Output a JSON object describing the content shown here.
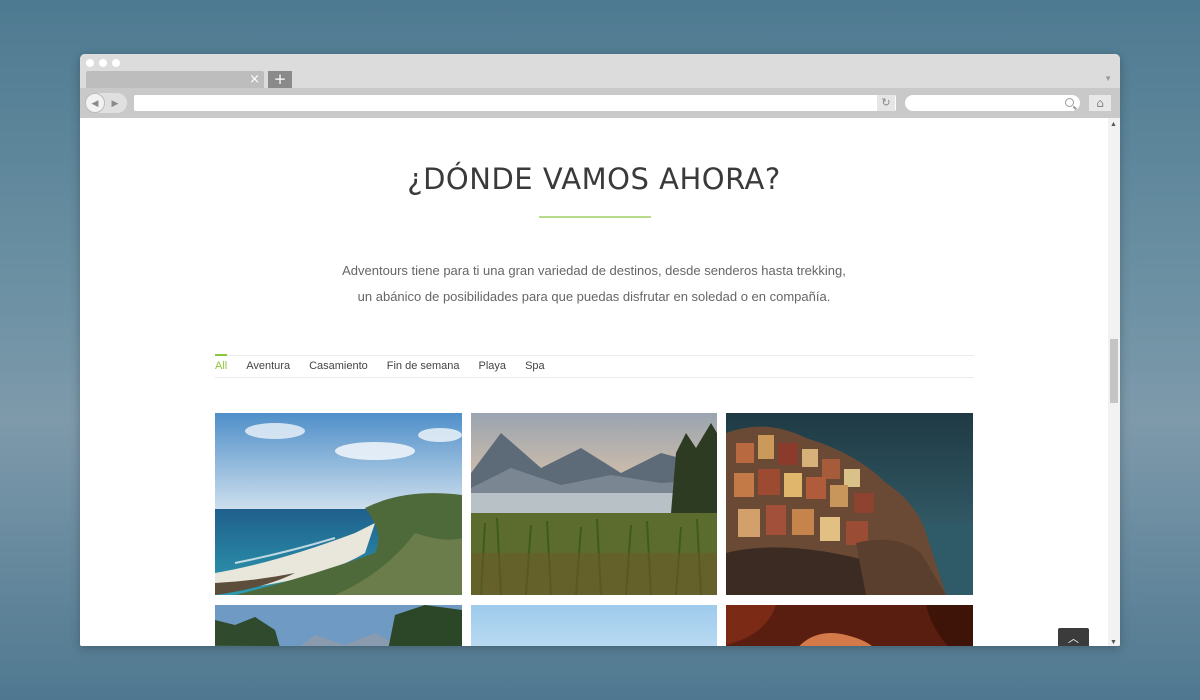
{
  "browser": {
    "tab_close": "×",
    "new_tab": "+",
    "reload_icon": "reload-icon",
    "home_icon": "home-icon"
  },
  "page": {
    "title": "¿DÓNDE VAMOS AHORA?",
    "intro_line1": "Adventours tiene para ti una gran variedad de destinos, desde senderos hasta trekking,",
    "intro_line2": "un abánico de posibilidades para que puedas disfrutar en soledad o en compañía.",
    "accent_color": "#8dc63f",
    "filters": [
      {
        "label": "All",
        "active": true
      },
      {
        "label": "Aventura",
        "active": false
      },
      {
        "label": "Casamiento",
        "active": false
      },
      {
        "label": "Fin de semana",
        "active": false
      },
      {
        "label": "Playa",
        "active": false
      },
      {
        "label": "Spa",
        "active": false
      }
    ],
    "gallery": [
      "coastal-beach-photo",
      "lake-mountains-photo",
      "cliff-village-photo",
      "forest-mountains-photo",
      "blue-sky-photo",
      "red-canyon-photo"
    ]
  }
}
